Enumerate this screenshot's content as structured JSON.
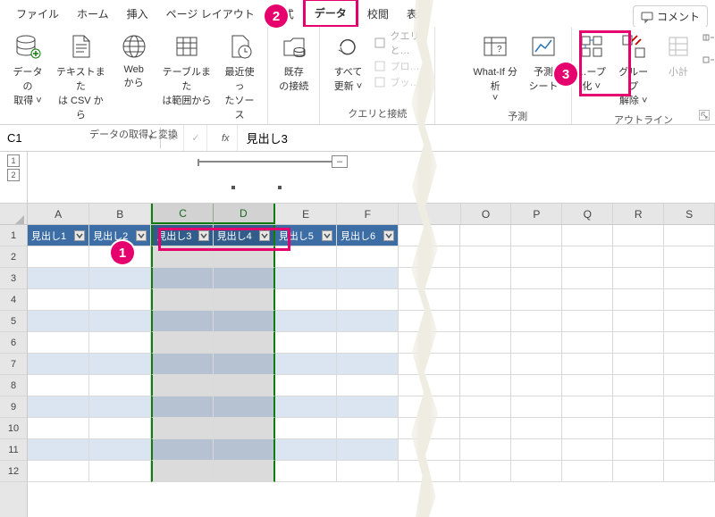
{
  "menu": {
    "items": [
      "ファイル",
      "ホーム",
      "挿入",
      "ページ レイアウト",
      "数式",
      "データ",
      "校閲",
      "表示"
    ],
    "active_index": 5
  },
  "ribbon": {
    "get_transform": {
      "btn_get_data": "データの\n取得 ˅",
      "btn_text_csv": "テキストまた\nは CSV から",
      "btn_web": "Web\nから",
      "btn_table_range": "テーブルまた\nは範囲から",
      "btn_recent": "最近使っ\nたソース",
      "label": "データの取得と変換"
    },
    "existing_conn": "既存\nの接続",
    "queries": {
      "refresh_all": "すべて\n更新 ˅",
      "side_a": "クエリと…",
      "side_b": "プロ…",
      "side_c": "ブッ…",
      "label": "クエリと接続"
    },
    "forecast": {
      "whatif": "What-If 分析\n˅",
      "sheet": "予測\nシート",
      "label": "予測"
    },
    "outline": {
      "group": "…ープ\n化 ˅",
      "ungroup": "グループ\n解除 ˅",
      "subtotal": "小計",
      "label": "アウトライン"
    }
  },
  "namebox": {
    "ref": "C1"
  },
  "formula": {
    "value": "見出し3"
  },
  "outline_levels": [
    "1",
    "2"
  ],
  "columns": [
    "A",
    "B",
    "C",
    "D",
    "E",
    "F",
    "",
    "O",
    "P",
    "Q",
    "R",
    "S"
  ],
  "selected_cols": [
    2,
    3
  ],
  "rows": [
    "1",
    "2",
    "3",
    "4",
    "5",
    "6",
    "7",
    "8",
    "9",
    "10",
    "11",
    "12"
  ],
  "table_headers": [
    "見出し1",
    "見出し2",
    "見出し3",
    "見出し4",
    "見出し5",
    "見出し6"
  ],
  "comment_btn": "コメント",
  "badges": {
    "b1": "1",
    "b2": "2",
    "b3": "3"
  }
}
